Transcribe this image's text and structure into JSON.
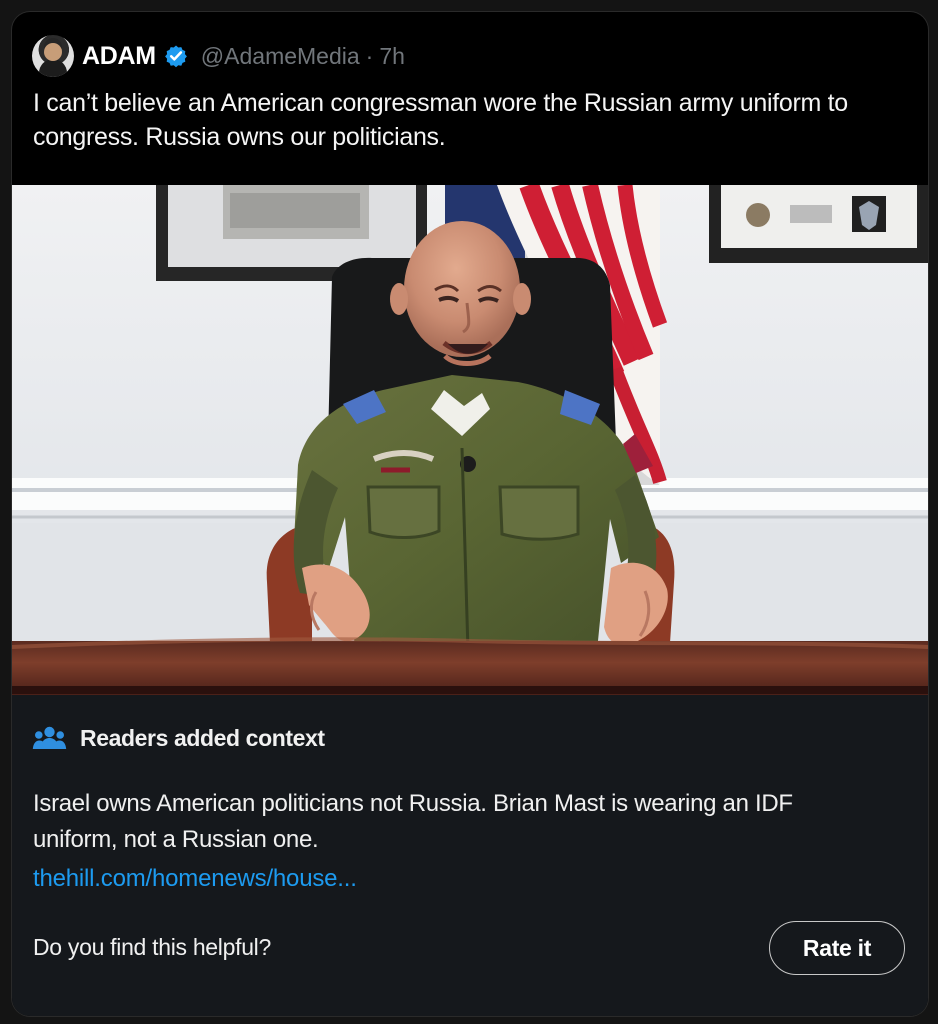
{
  "post": {
    "display_name": "ADAM",
    "handle": "@AdameMedia",
    "dot": "·",
    "time": "7h",
    "text": "I can’t believe an American congressman wore the Russian army uniform to congress. Russia owns our politicians."
  },
  "icons": {
    "avatar": "profile-avatar",
    "verified": "verified-badge-icon",
    "readers": "readers-icon"
  },
  "colors": {
    "background": "#000000",
    "note_background": "#15181c",
    "text": "#e7e9ea",
    "muted": "#71767b",
    "link": "#1d9bf0",
    "verified": "#1d9bf0"
  },
  "community_note": {
    "heading": "Readers added context",
    "body": "Israel owns American politicians not Russia. Brian Mast is wearing an IDF uniform, not a Russian one.",
    "link": "thehill.com/homenews/house...",
    "question": "Do you find this helpful?",
    "button": "Rate it"
  }
}
